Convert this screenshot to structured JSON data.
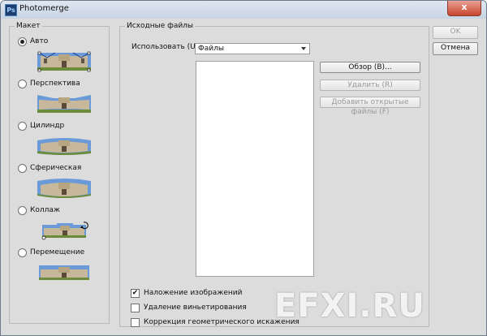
{
  "window": {
    "title": "Photomerge",
    "close_label": "x"
  },
  "layout": {
    "legend": "Макет",
    "options": [
      {
        "label": "Авто",
        "selected": true
      },
      {
        "label": "Перспектива",
        "selected": false
      },
      {
        "label": "Цилиндр",
        "selected": false
      },
      {
        "label": "Сферическая",
        "selected": false
      },
      {
        "label": "Коллаж",
        "selected": false
      },
      {
        "label": "Перемещение",
        "selected": false
      }
    ]
  },
  "source": {
    "legend": "Исходные файлы",
    "use_label": "Использовать (U):",
    "use_value": "Файлы",
    "buttons": {
      "browse": "Обзор (В)...",
      "remove": "Удалить (R)",
      "add_open": "Добавить открытые файлы (F)"
    },
    "checkboxes": [
      {
        "label": "Наложение изображений",
        "checked": true
      },
      {
        "label": "Удаление виньетирования",
        "checked": false
      },
      {
        "label": "Коррекция геометрического искажения",
        "checked": false
      }
    ]
  },
  "actions": {
    "ok": "OK",
    "cancel": "Отмена"
  },
  "watermark": "EFXI.RU"
}
